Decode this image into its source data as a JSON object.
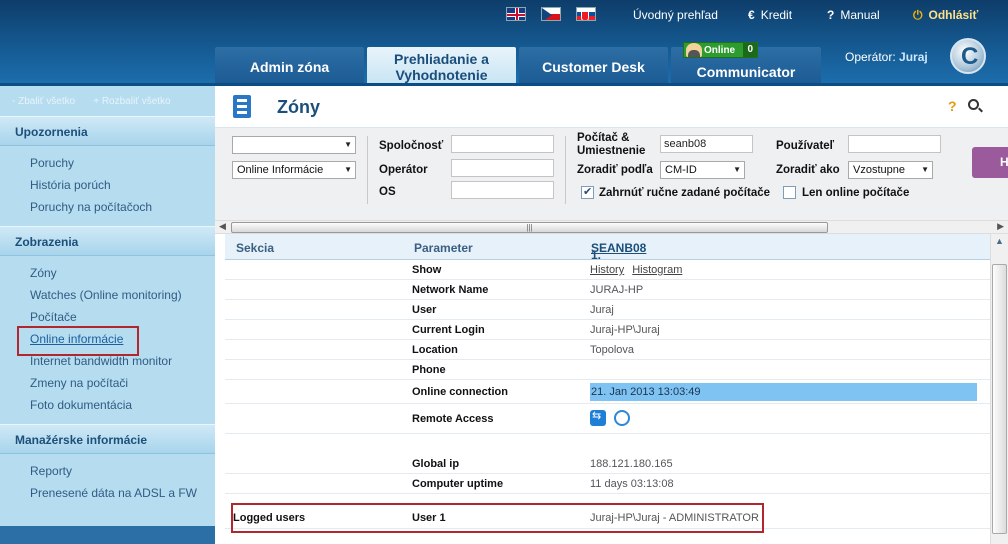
{
  "header": {
    "top_links": {
      "home": "Úvodný prehľad",
      "credit": "Kredit",
      "manual": "Manual",
      "logout": "Odhlásiť"
    },
    "tabs": [
      {
        "label": "Admin zóna"
      },
      {
        "label": "Prehliadanie a Vyhodnotenie"
      },
      {
        "label": "Customer Desk"
      },
      {
        "label": "Communicator"
      }
    ],
    "online_badge": {
      "label": "Online",
      "count": "0"
    },
    "operator_label": "Operátor:",
    "operator_name": "Juraj",
    "logo_letter": "C"
  },
  "sidebar": {
    "collapse_all": "- Zbaliť všetko",
    "expand_all": "+ Rozbaliť všetko",
    "sections": [
      {
        "title": "Upozornenia",
        "items": [
          "Poruchy",
          "História porúch",
          "Poruchy na počítačoch"
        ]
      },
      {
        "title": "Zobrazenia",
        "items": [
          "Zóny",
          "Watches (Online monitoring)",
          "Počítače",
          "Online informácie",
          "Internet bandwidth monitor",
          "Zmeny na počítači",
          "Foto dokumentácia"
        ]
      },
      {
        "title": "Manažérske informácie",
        "items": [
          "Reporty",
          "Prenesené dáta na ADSL a FW"
        ]
      }
    ]
  },
  "page": {
    "title": "Zóny",
    "help": "?"
  },
  "filters": {
    "select1_value": "",
    "select2_value": "Online Informácie",
    "company_label": "Spoločnosť",
    "operator_label": "Operátor",
    "os_label": "OS",
    "computer_label": "Počítač & Umiestnenie",
    "computer_value": "seanb08",
    "sort_by_label": "Zoradiť podľa",
    "sort_by_value": "CM-ID",
    "include_manual_label": "Zahrnúť ručne zadané počítače",
    "user_label": "Používateľ",
    "sort_label": "Zoradiť ako",
    "sort_value": "Vzostupne",
    "online_only_label": "Len online počítače",
    "button_label": "H"
  },
  "grid": {
    "col_section": "Sekcia",
    "col_parameter": "Parameter",
    "col_computer_num": "1.",
    "col_computer_name": "SEANB08",
    "rows": {
      "show_label": "Show",
      "show_history": "History",
      "show_histogram": "Histogram",
      "network_name_label": "Network Name",
      "network_name_value": "JURAJ-HP",
      "user_label": "User",
      "user_value": "Juraj",
      "current_login_label": "Current Login",
      "current_login_value": "Juraj-HP\\Juraj",
      "location_label": "Location",
      "location_value": "Topolova",
      "phone_label": "Phone",
      "online_connection_label": "Online connection",
      "online_connection_value": "21. Jan 2013 13:03:49",
      "remote_access_label": "Remote Access",
      "global_ip_label": "Global ip",
      "global_ip_value": "188.121.180.165",
      "uptime_label": "Computer uptime",
      "uptime_value": "11 days 03:13:08",
      "logged_users_section": "Logged users",
      "logged_user_label": "User 1",
      "logged_user_value": "Juraj-HP\\Juraj - ADMINISTRATOR"
    }
  }
}
